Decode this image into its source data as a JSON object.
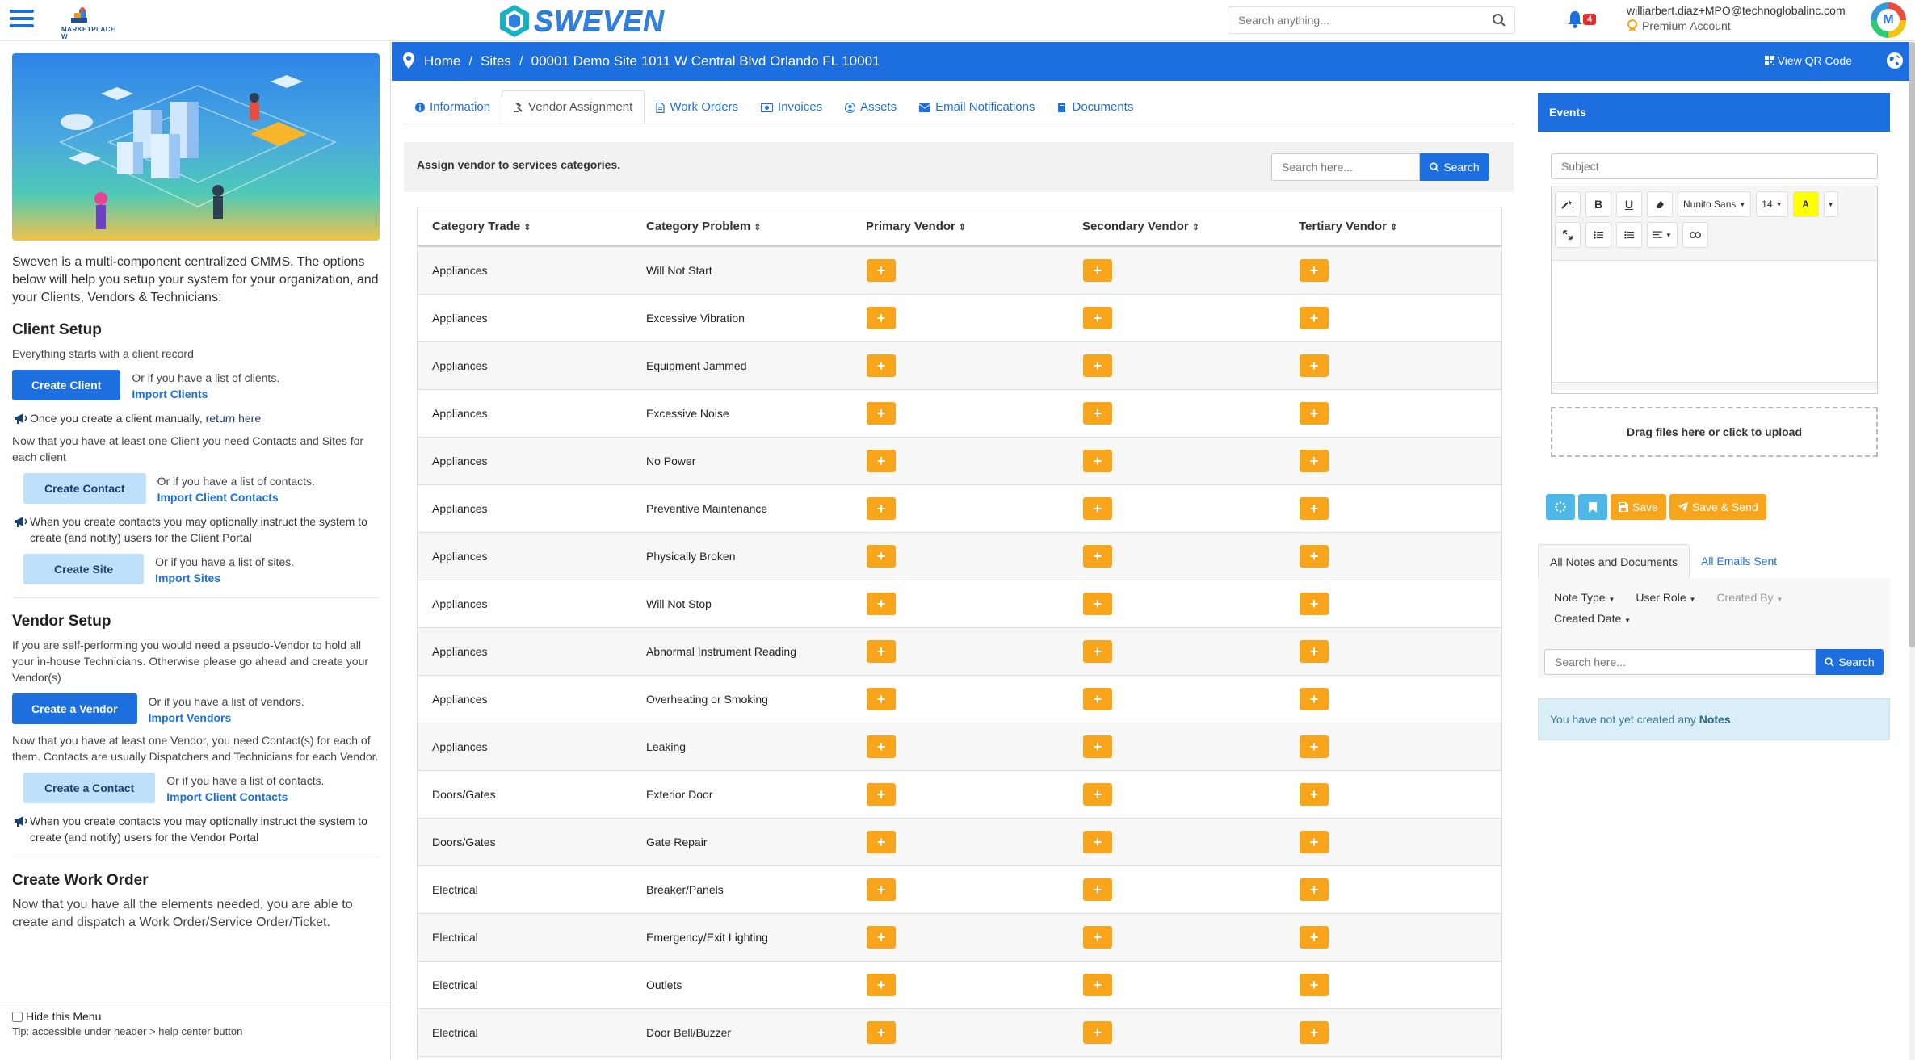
{
  "header": {
    "marketplace_label": "MARKETPLACE W",
    "brand": "SWEVEN",
    "search_placeholder": "Search anything...",
    "notif_count": "4",
    "user_email": "williarbert.diaz+MPO@technoglobalinc.com",
    "account_type": "Premium Account",
    "avatar_initial": "M"
  },
  "sidebar": {
    "intro": "Sweven is a multi-component centralized CMMS. The options below will help you setup your system for your organization, and your Clients, Vendors & Technicians:",
    "client_setup": {
      "heading": "Client Setup",
      "desc": "Everything starts with a client record",
      "create_client": "Create Client",
      "or_clients": "Or if you have a list of clients.",
      "import_clients": "Import Clients",
      "note1_pre": "Once you create a client manually, ",
      "note1_link": "return here",
      "desc2": "Now that you have at least one Client you need Contacts and Sites for each client",
      "create_contact": "Create Contact",
      "or_contacts": "Or if you have a list of contacts.",
      "import_client_contacts": "Import Client Contacts",
      "note2": "When you create contacts you may optionally instruct the system to create (and notify) users for the Client Portal",
      "create_site": "Create Site",
      "or_sites": "Or if you have a list of sites.",
      "import_sites": "Import Sites"
    },
    "vendor_setup": {
      "heading": "Vendor Setup",
      "desc": "If you are self-performing you would need a pseudo-Vendor to hold all your in-house Technicians. Otherwise please go ahead and create your Vendor(s)",
      "create_vendor": "Create a Vendor",
      "or_vendors": "Or if you have a list of vendors.",
      "import_vendors": "Import Vendors",
      "desc2": "Now that you have at least one Vendor, you need Contact(s) for each of them. Contacts are usually Dispatchers and Technicians for each Vendor.",
      "create_contact": "Create a Contact",
      "or_contacts": "Or if you have a list of contacts.",
      "import_client_contacts": "Import Client Contacts",
      "note": "When you create contacts you may optionally instruct the system to create (and notify) users for the Vendor Portal"
    },
    "work_order": {
      "heading": "Create Work Order",
      "desc": "Now that you have all the elements needed, you are able to create and dispatch a Work Order/Service Order/Ticket."
    },
    "hide_menu": "Hide this Menu",
    "tip": "Tip: accessible under header > help center button"
  },
  "breadcrumb": {
    "home": "Home",
    "sites": "Sites",
    "current": "00001 Demo Site 1011 W Central Blvd Orlando FL 10001",
    "qr": "View QR Code"
  },
  "tabs": [
    "Information",
    "Vendor Assignment",
    "Work Orders",
    "Invoices",
    "Assets",
    "Email Notifications",
    "Documents"
  ],
  "assign": {
    "label": "Assign vendor to services categories.",
    "search_placeholder": "Search here...",
    "search_button": "Search"
  },
  "table": {
    "headers": [
      "Category Trade",
      "Category Problem",
      "Primary Vendor",
      "Secondary Vendor",
      "Tertiary Vendor"
    ],
    "rows": [
      [
        "Appliances",
        "Will Not Start"
      ],
      [
        "Appliances",
        "Excessive Vibration"
      ],
      [
        "Appliances",
        "Equipment Jammed"
      ],
      [
        "Appliances",
        "Excessive Noise"
      ],
      [
        "Appliances",
        "No Power"
      ],
      [
        "Appliances",
        "Preventive Maintenance"
      ],
      [
        "Appliances",
        "Physically Broken"
      ],
      [
        "Appliances",
        "Will Not Stop"
      ],
      [
        "Appliances",
        "Abnormal Instrument Reading"
      ],
      [
        "Appliances",
        "Overheating or Smoking"
      ],
      [
        "Appliances",
        "Leaking"
      ],
      [
        "Doors/Gates",
        "Exterior Door"
      ],
      [
        "Doors/Gates",
        "Gate Repair"
      ],
      [
        "Electrical",
        "Breaker/Panels"
      ],
      [
        "Electrical",
        "Emergency/Exit Lighting"
      ],
      [
        "Electrical",
        "Outlets"
      ],
      [
        "Electrical",
        "Door Bell/Buzzer"
      ]
    ],
    "plus": "+"
  },
  "events": {
    "title": "Events",
    "subject_placeholder": "Subject",
    "font": "Nunito Sans",
    "size": "14",
    "drop": "Drag files here or click to upload",
    "save": "Save",
    "save_send": "Save & Send",
    "tab_notes": "All Notes and Documents",
    "tab_emails": "All Emails Sent",
    "filters": [
      "Note Type",
      "User Role",
      "Created By",
      "Created Date"
    ],
    "search_placeholder": "Search here...",
    "search_button": "Search",
    "alert_pre": "You have not yet created any ",
    "alert_bold": "Notes",
    "alert_post": "."
  },
  "colors": {
    "primary": "#1d6fe0",
    "orange": "#f8a51c",
    "info": "#4db8e8",
    "danger": "#e82c2c"
  }
}
